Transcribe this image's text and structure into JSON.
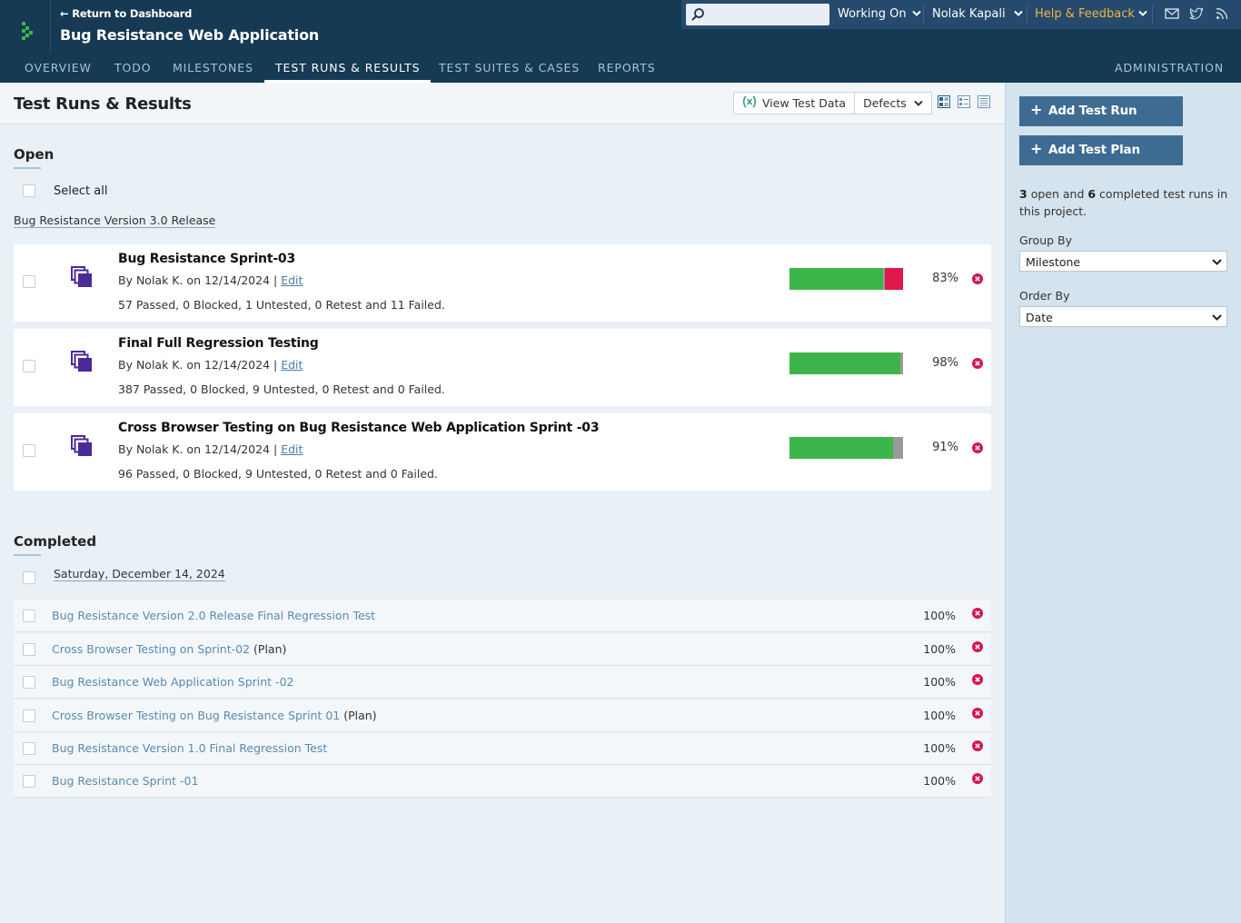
{
  "header": {
    "return_link": "← Return to Dashboard",
    "project_title": "Bug Resistance Web Application",
    "search": {
      "placeholder": "",
      "value": ""
    },
    "working_on": "Working On",
    "user_name": "Nolak Kapali",
    "help_feedback": "Help & Feedback",
    "icons": [
      "logo-icon",
      "search-icon",
      "mail-icon",
      "twitter-icon",
      "rss-icon"
    ],
    "colors": {
      "header_bg": "#163954",
      "topbar_bg": "#254a6d",
      "help_accent": "#f1b43c"
    }
  },
  "nav": {
    "tabs": [
      {
        "label": "OVERVIEW"
      },
      {
        "label": "TODO"
      },
      {
        "label": "MILESTONES"
      },
      {
        "label": "TEST RUNS & RESULTS",
        "active": true
      },
      {
        "label": "TEST SUITES & CASES"
      },
      {
        "label": "REPORTS"
      }
    ],
    "admin_label": "ADMINISTRATION"
  },
  "page": {
    "title": "Test Runs & Results",
    "toolbar": {
      "view_test_data": "View Test Data",
      "defects": "Defects"
    },
    "view_icons": [
      "detail-view-icon",
      "compact-view-icon",
      "list-view-icon"
    ]
  },
  "open": {
    "heading": "Open",
    "select_all": "Select all",
    "milestone": "Bug Resistance Version 3.0 Release",
    "runs": [
      {
        "name": "Bug Resistance Sprint-03",
        "meta_prefix": "By Nolak K. on 12/14/2024 |",
        "edit": "Edit",
        "stats": "57 Passed, 0 Blocked, 1 Untested, 0 Retest and 11 Failed.",
        "percent": "83%",
        "passed": 57,
        "untested": 1,
        "failed": 11
      },
      {
        "name": "Final Full Regression Testing",
        "meta_prefix": "By Nolak K. on 12/14/2024 |",
        "edit": "Edit",
        "stats": "387 Passed, 0 Blocked, 9 Untested, 0 Retest and 0 Failed.",
        "percent": "98%",
        "passed": 387,
        "untested": 9,
        "failed": 0
      },
      {
        "name": "Cross Browser Testing on Bug Resistance Web Application Sprint -03",
        "meta_prefix": "By Nolak K. on 12/14/2024 |",
        "edit": "Edit",
        "stats": "96 Passed, 0 Blocked, 9 Untested, 0 Retest and 0 Failed.",
        "percent": "91%",
        "passed": 96,
        "untested": 9,
        "failed": 0
      }
    ]
  },
  "completed": {
    "heading": "Completed",
    "date": "Saturday, December 14, 2024",
    "runs": [
      {
        "name": "Bug Resistance Version 2.0 Release Final Regression Test",
        "plan": "",
        "percent": "100%"
      },
      {
        "name": "Cross Browser Testing on Sprint-02",
        "plan": "(Plan)",
        "percent": "100%"
      },
      {
        "name": "Bug Resistance Web Application Sprint -02",
        "plan": "",
        "percent": "100%"
      },
      {
        "name": "Cross Browser Testing on Bug Resistance Sprint 01",
        "plan": "(Plan)",
        "percent": "100%"
      },
      {
        "name": "Bug Resistance Version 1.0 Final Regression Test",
        "plan": "",
        "percent": "100%"
      },
      {
        "name": "Bug Resistance Sprint -01",
        "plan": "",
        "percent": "100%"
      }
    ]
  },
  "sidebar": {
    "add_run": "Add Test Run",
    "add_plan": "Add Test Plan",
    "open_count": "3",
    "open_text": "open and",
    "completed_count": "6",
    "completed_text": "completed test runs in this project.",
    "group_by_label": "Group By",
    "group_by_value": "Milestone",
    "order_by_label": "Order By",
    "order_by_value": "Date"
  },
  "colors": {
    "passed": "#3cb64a",
    "failed": "#e0174a",
    "untested": "#999999",
    "button": "#3e6b92",
    "link": "#5b8ab0",
    "delete": "#d4164f"
  }
}
